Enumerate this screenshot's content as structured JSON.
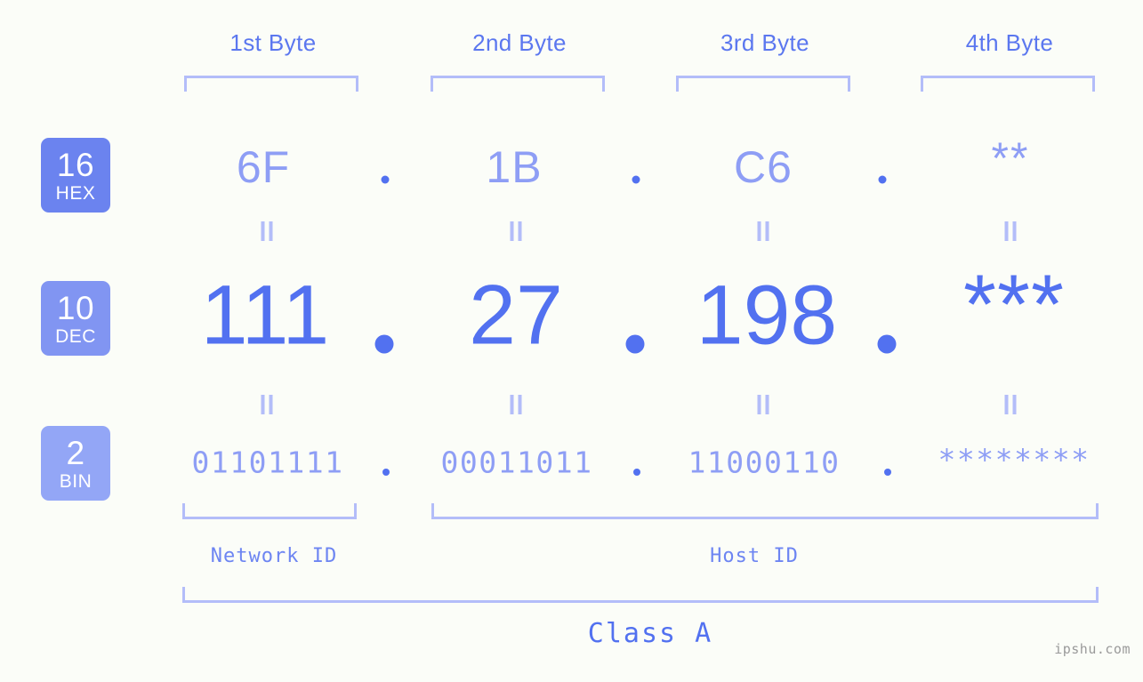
{
  "colors": {
    "background": "#fbfdf8",
    "accent_strong": "#5271f0",
    "accent_light": "#8e9ef5",
    "bracket": "#b3bdf9",
    "header_text": "#5b77ef",
    "badge_hex": "#6b83ef",
    "badge_dec": "#8195f2",
    "badge_bin": "#93a6f6",
    "watermark_text": "#9a9a9a"
  },
  "headers": {
    "bytes": [
      {
        "label": "1st Byte"
      },
      {
        "label": "2nd Byte"
      },
      {
        "label": "3rd Byte"
      },
      {
        "label": "4th Byte"
      }
    ]
  },
  "bases": [
    {
      "number": "16",
      "name": "HEX"
    },
    {
      "number": "10",
      "name": "DEC"
    },
    {
      "number": "2",
      "name": "BIN"
    }
  ],
  "rows": {
    "hex": {
      "base_number": "16",
      "base_name": "HEX",
      "values": [
        "6F",
        "1B",
        "C6",
        "**"
      ],
      "separator": "."
    },
    "dec": {
      "base_number": "10",
      "base_name": "DEC",
      "values": [
        "111",
        "27",
        "198",
        "***"
      ],
      "separator": "."
    },
    "bin": {
      "base_number": "2",
      "base_name": "BIN",
      "values": [
        "01101111",
        "00011011",
        "11000110",
        "********"
      ],
      "separator": "."
    }
  },
  "equals_marks": {
    "symbol": "="
  },
  "zones": [
    {
      "name": "network-id",
      "label": "Network ID"
    },
    {
      "name": "host-id",
      "label": "Host ID"
    }
  ],
  "class": {
    "label": "Class A"
  },
  "watermark": {
    "text": "ipshu.com"
  }
}
